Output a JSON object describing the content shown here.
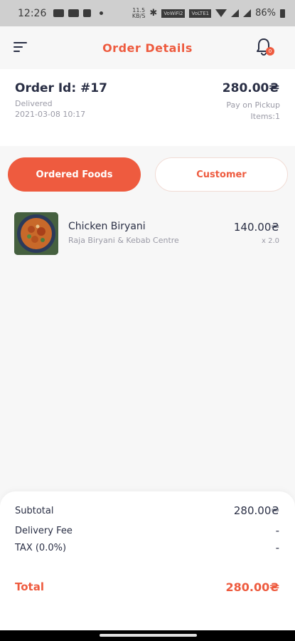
{
  "status_bar": {
    "time": "12:26",
    "speed": "11.5",
    "speed_unit": "KB/S",
    "net1": "VoWiFi2",
    "net2": "VoLTE1",
    "battery": "86%"
  },
  "header": {
    "title": "Order Details",
    "notification_count": "0"
  },
  "order": {
    "id_label": "Order Id: #17",
    "status": "Delivered",
    "date": "2021-03-08 10:17",
    "total": "280.00₴",
    "payment_method": "Pay on Pickup",
    "items_count": "Items:1"
  },
  "tabs": {
    "ordered_foods": "Ordered Foods",
    "customer": "Customer"
  },
  "foods": [
    {
      "name": "Chicken Biryani",
      "restaurant": "Raja Biryani & Kebab Centre",
      "price": "140.00₴",
      "quantity": "x 2.0"
    }
  ],
  "totals": {
    "subtotal_label": "Subtotal",
    "subtotal_value": "280.00₴",
    "delivery_label": "Delivery Fee",
    "delivery_value": "-",
    "tax_label": "TAX (0.0%)",
    "tax_value": "-",
    "total_label": "Total",
    "total_value": "280.00₴"
  },
  "colors": {
    "accent": "#ee5b3f",
    "text_dark": "#2a2f45",
    "text_muted": "#9a9aa6"
  }
}
